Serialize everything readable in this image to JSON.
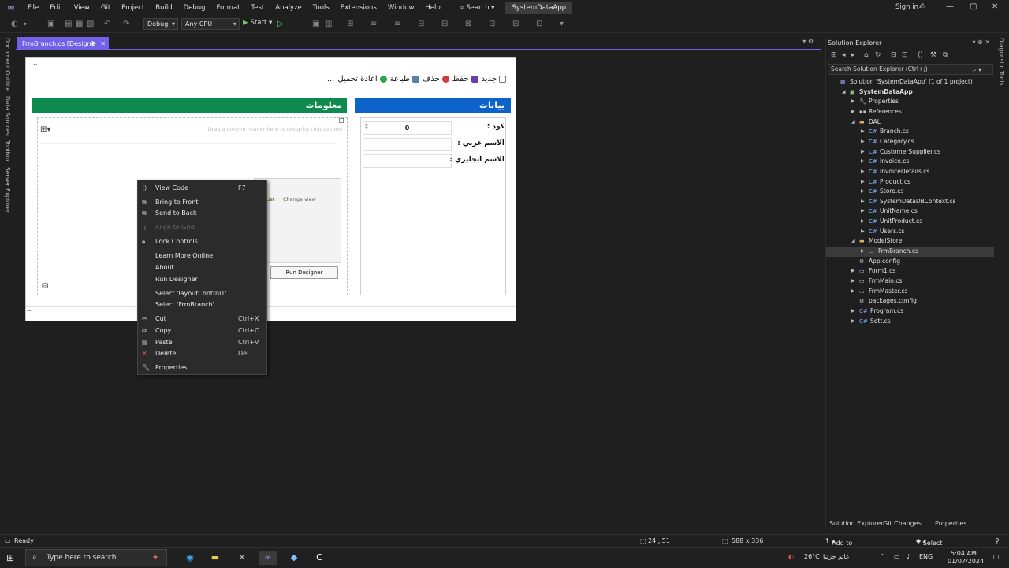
{
  "menubar": {
    "items": [
      "File",
      "Edit",
      "View",
      "Git",
      "Project",
      "Build",
      "Debug",
      "Format",
      "Test",
      "Analyze",
      "Tools",
      "Extensions",
      "Window",
      "Help"
    ],
    "search": "Search",
    "solution_name": "SystemDataApp",
    "signin": "Sign in"
  },
  "toolbar": {
    "config": "Debug",
    "platform": "Any CPU",
    "start_label": "Start"
  },
  "left_strip": [
    "Document Outline",
    "Data Sources",
    "Toolbox",
    "Server Explorer"
  ],
  "right_strip": [
    "Diagnostic Tools"
  ],
  "document_tab": {
    "label": "FrmBranch.cs [Design]"
  },
  "form": {
    "title_dots": "...",
    "toolbar_buttons": [
      "جديد",
      "حفظ",
      "حذف",
      "طباعة",
      "اعادة تحميل",
      "..."
    ],
    "info_header": "معلومات",
    "data_header": "بيانات",
    "grid_hint": "Drag a column header here to group by that column",
    "list_label": "List",
    "change_view": "Change view",
    "run_designer": "Run Designer",
    "fields": [
      {
        "label": "كود :",
        "value": "0"
      },
      {
        "label": "الاسم عربي :",
        "value": ""
      },
      {
        "label": "الاسم انجليزي :",
        "value": ""
      }
    ]
  },
  "context_menu": {
    "items": [
      {
        "label": "View Code",
        "shortcut": "F7",
        "icon": "code-icon",
        "disabled": false
      },
      {
        "label": "Bring to Front",
        "shortcut": "",
        "icon": "bring-front-icon",
        "disabled": false
      },
      {
        "label": "Send to Back",
        "shortcut": "",
        "icon": "send-back-icon",
        "disabled": false
      },
      {
        "label": "Align to Grid",
        "shortcut": "",
        "icon": "align-grid-icon",
        "disabled": true
      },
      {
        "label": "Lock Controls",
        "shortcut": "",
        "icon": "lock-icon",
        "disabled": false
      },
      {
        "label": "Learn More Online",
        "shortcut": "",
        "icon": "",
        "disabled": false
      },
      {
        "label": "About",
        "shortcut": "",
        "icon": "",
        "disabled": false
      },
      {
        "label": "Run Designer",
        "shortcut": "",
        "icon": "",
        "disabled": false
      },
      {
        "label": "Select 'layoutControl1'",
        "shortcut": "",
        "icon": "",
        "disabled": false
      },
      {
        "label": "Select 'FrmBranch'",
        "shortcut": "",
        "icon": "",
        "disabled": false
      },
      {
        "label": "Cut",
        "shortcut": "Ctrl+X",
        "icon": "cut-icon",
        "disabled": false
      },
      {
        "label": "Copy",
        "shortcut": "Ctrl+C",
        "icon": "copy-icon",
        "disabled": false
      },
      {
        "label": "Paste",
        "shortcut": "Ctrl+V",
        "icon": "paste-icon",
        "disabled": false
      },
      {
        "label": "Delete",
        "shortcut": "Del",
        "icon": "delete-icon",
        "disabled": false
      },
      {
        "label": "Properties",
        "shortcut": "",
        "icon": "wrench-icon",
        "disabled": false
      }
    ]
  },
  "solution_explorer": {
    "title": "Solution Explorer",
    "search_placeholder": "Search Solution Explorer (Ctrl+;)",
    "tree": [
      {
        "label": "Solution 'SystemDataApp' (1 of 1 project)",
        "depth": 0,
        "exp": "",
        "icon": "solution"
      },
      {
        "label": "SystemDataApp",
        "depth": 1,
        "exp": "open",
        "icon": "project",
        "bold": true
      },
      {
        "label": "Properties",
        "depth": 2,
        "exp": "closed",
        "icon": "wrench"
      },
      {
        "label": "References",
        "depth": 2,
        "exp": "closed",
        "icon": "refs"
      },
      {
        "label": "DAL",
        "depth": 2,
        "exp": "open",
        "icon": "folder"
      },
      {
        "label": "Branch.cs",
        "depth": 3,
        "exp": "closed",
        "icon": "cs"
      },
      {
        "label": "Category.cs",
        "depth": 3,
        "exp": "closed",
        "icon": "cs"
      },
      {
        "label": "CustomerSupplier.cs",
        "depth": 3,
        "exp": "closed",
        "icon": "cs"
      },
      {
        "label": "Invoice.cs",
        "depth": 3,
        "exp": "closed",
        "icon": "cs"
      },
      {
        "label": "InvoiceDetails.cs",
        "depth": 3,
        "exp": "closed",
        "icon": "cs"
      },
      {
        "label": "Product.cs",
        "depth": 3,
        "exp": "closed",
        "icon": "cs"
      },
      {
        "label": "Store.cs",
        "depth": 3,
        "exp": "closed",
        "icon": "cs"
      },
      {
        "label": "SystemDataDBContext.cs",
        "depth": 3,
        "exp": "closed",
        "icon": "cs"
      },
      {
        "label": "UnitName.cs",
        "depth": 3,
        "exp": "closed",
        "icon": "cs"
      },
      {
        "label": "UnitProduct.cs",
        "depth": 3,
        "exp": "closed",
        "icon": "cs"
      },
      {
        "label": "Users.cs",
        "depth": 3,
        "exp": "closed",
        "icon": "cs"
      },
      {
        "label": "ModelStore",
        "depth": 2,
        "exp": "open",
        "icon": "folder"
      },
      {
        "label": "FrmBranch.cs",
        "depth": 3,
        "exp": "closed",
        "icon": "form",
        "selected": true
      },
      {
        "label": "App.config",
        "depth": 2,
        "exp": "",
        "icon": "config"
      },
      {
        "label": "Form1.cs",
        "depth": 2,
        "exp": "closed",
        "icon": "form"
      },
      {
        "label": "FrmMain.cs",
        "depth": 2,
        "exp": "closed",
        "icon": "form"
      },
      {
        "label": "FrmMaster.cs",
        "depth": 2,
        "exp": "closed",
        "icon": "form"
      },
      {
        "label": "packages.config",
        "depth": 2,
        "exp": "",
        "icon": "config"
      },
      {
        "label": "Program.cs",
        "depth": 2,
        "exp": "closed",
        "icon": "cs"
      },
      {
        "label": "Sett.cs",
        "depth": 2,
        "exp": "closed",
        "icon": "cs"
      }
    ],
    "tabs": [
      "Solution Explorer",
      "Git Changes",
      "Properties"
    ]
  },
  "statusbar": {
    "ready": "Ready",
    "position": "24 , 51",
    "size": "588 x 336",
    "add_source": "Add to Source Control",
    "select_repo": "Select Repository"
  },
  "taskbar": {
    "search_placeholder": "Type here to search",
    "weather": "26°C",
    "weather_desc": "غائم جزئيا",
    "lang": "ENG",
    "time": "5:04 AM",
    "date": "01/07/2024"
  },
  "colors": {
    "accent": "#7160e8",
    "green_header": "#0e8a4e",
    "blue_header": "#0d63c9"
  }
}
